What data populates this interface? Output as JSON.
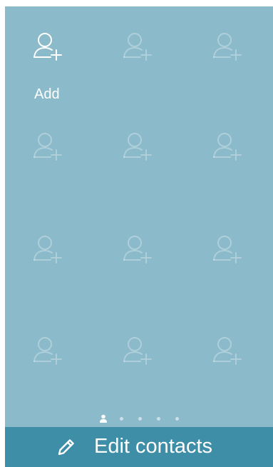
{
  "favorites": {
    "add_label": "Add",
    "slots": [
      {
        "state": "add",
        "icon": "add-contact-icon"
      },
      {
        "state": "empty",
        "icon": "add-contact-icon"
      },
      {
        "state": "empty",
        "icon": "add-contact-icon"
      },
      {
        "state": "empty",
        "icon": "add-contact-icon"
      },
      {
        "state": "empty",
        "icon": "add-contact-icon"
      },
      {
        "state": "empty",
        "icon": "add-contact-icon"
      },
      {
        "state": "empty",
        "icon": "add-contact-icon"
      },
      {
        "state": "empty",
        "icon": "add-contact-icon"
      },
      {
        "state": "empty",
        "icon": "add-contact-icon"
      },
      {
        "state": "empty",
        "icon": "add-contact-icon"
      },
      {
        "state": "empty",
        "icon": "add-contact-icon"
      },
      {
        "state": "empty",
        "icon": "add-contact-icon"
      }
    ]
  },
  "pager": {
    "current_page": 1,
    "total_pages": 5,
    "current_icon": "person-icon"
  },
  "bottom_bar": {
    "icon": "pencil-icon",
    "label": "Edit contacts"
  },
  "colors": {
    "background": "#8bbaca",
    "bar": "#3e8ea8",
    "foreground": "#ffffff"
  }
}
